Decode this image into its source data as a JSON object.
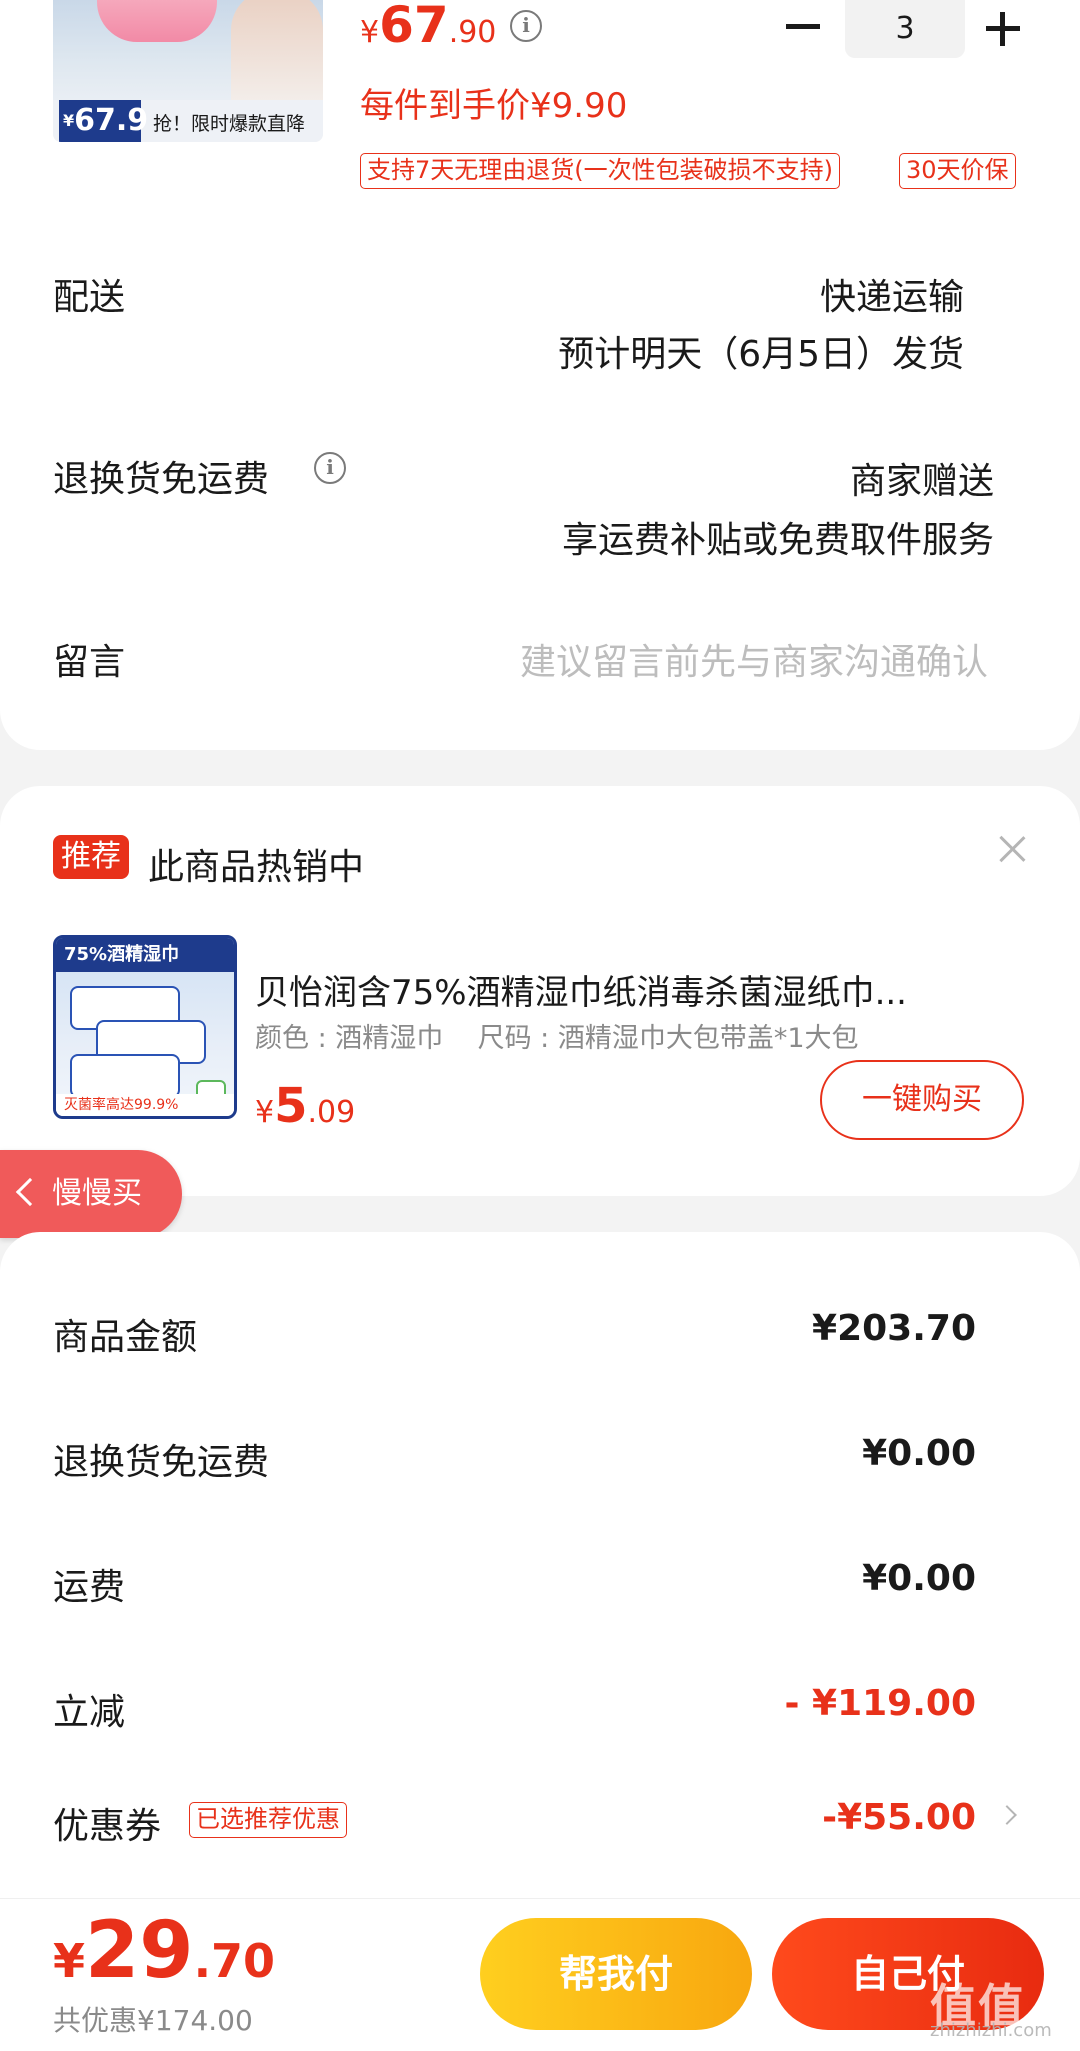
{
  "product_top": {
    "thumb_price": "67.9",
    "thumb_text": "抢！限时爆款直降",
    "price_symbol": "¥",
    "price_int": "67",
    "price_dec": ".90",
    "unit_price": "每件到手价¥9.90",
    "quantity": "3",
    "tags": [
      "支持7天无理由退货(一次性包装破损不支持)",
      "30天价保"
    ]
  },
  "delivery": {
    "label": "配送",
    "method": "快递运输",
    "eta": "预计明天（6月5日）发货"
  },
  "return_shipping": {
    "label": "退换货免运费",
    "value1": "商家赠送",
    "value2": "享运费补贴或免费取件服务"
  },
  "message": {
    "label": "留言",
    "placeholder": "建议留言前先与商家沟通确认"
  },
  "recommend": {
    "badge": "推荐",
    "title": "此商品热销中",
    "thumb_top": "75%酒精湿巾",
    "thumb_bottom": "灭菌率高达99.9%",
    "name": "贝怡润含75%酒精湿巾纸消毒杀菌湿纸巾...",
    "attrs": "颜色 : 酒精湿巾    尺码 : 酒精湿巾大包带盖*1大包",
    "price_symbol": "¥",
    "price_int": "5",
    "price_dec": ".09",
    "buy_label": "一键购买"
  },
  "slow_buy": {
    "label": "慢慢买"
  },
  "summary": {
    "rows": [
      {
        "label": "商品金额",
        "value": "¥203.70",
        "color": "#1a1a1a"
      },
      {
        "label": "退换货免运费",
        "value": "¥0.00",
        "color": "#1a1a1a"
      },
      {
        "label": "运费",
        "value": "¥0.00",
        "color": "#1a1a1a"
      },
      {
        "label": "立减",
        "value": "- ¥119.00",
        "color": "#e8311a"
      }
    ],
    "coupon_label": "优惠券",
    "coupon_tag": "已选推荐优惠",
    "coupon_value": "-¥55.00"
  },
  "bottom": {
    "price_symbol": "¥",
    "price_int": "29",
    "price_dec": ".70",
    "saving": "共优惠¥174.00",
    "help_pay": "帮我付",
    "self_pay": "自己付"
  },
  "watermark": {
    "text": "值值值",
    "site": "zhizhizhi.com"
  },
  "colors": {
    "accent": "#e8311a",
    "help_button": "#f8a70f",
    "slow_buy": "#f05a5a"
  }
}
